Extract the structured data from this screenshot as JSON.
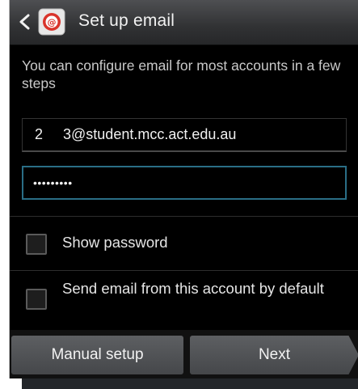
{
  "header": {
    "title": "Set up email",
    "back_icon": "chevron-left-icon",
    "app_icon": "email-app-icon"
  },
  "intro_text": "You can configure email for most accounts in a few steps",
  "fields": {
    "email_value": "2     3@student.mcc.act.edu.au",
    "password_value": "•••••••••"
  },
  "options": {
    "show_password_label": "Show password",
    "show_password_checked": false,
    "default_account_label": "Send email from this account by default",
    "default_account_checked": false
  },
  "buttons": {
    "manual_setup_label": "Manual setup",
    "next_label": "Next"
  },
  "colors": {
    "focus_border": "#2a6e86",
    "icon_red": "#d9342b"
  }
}
